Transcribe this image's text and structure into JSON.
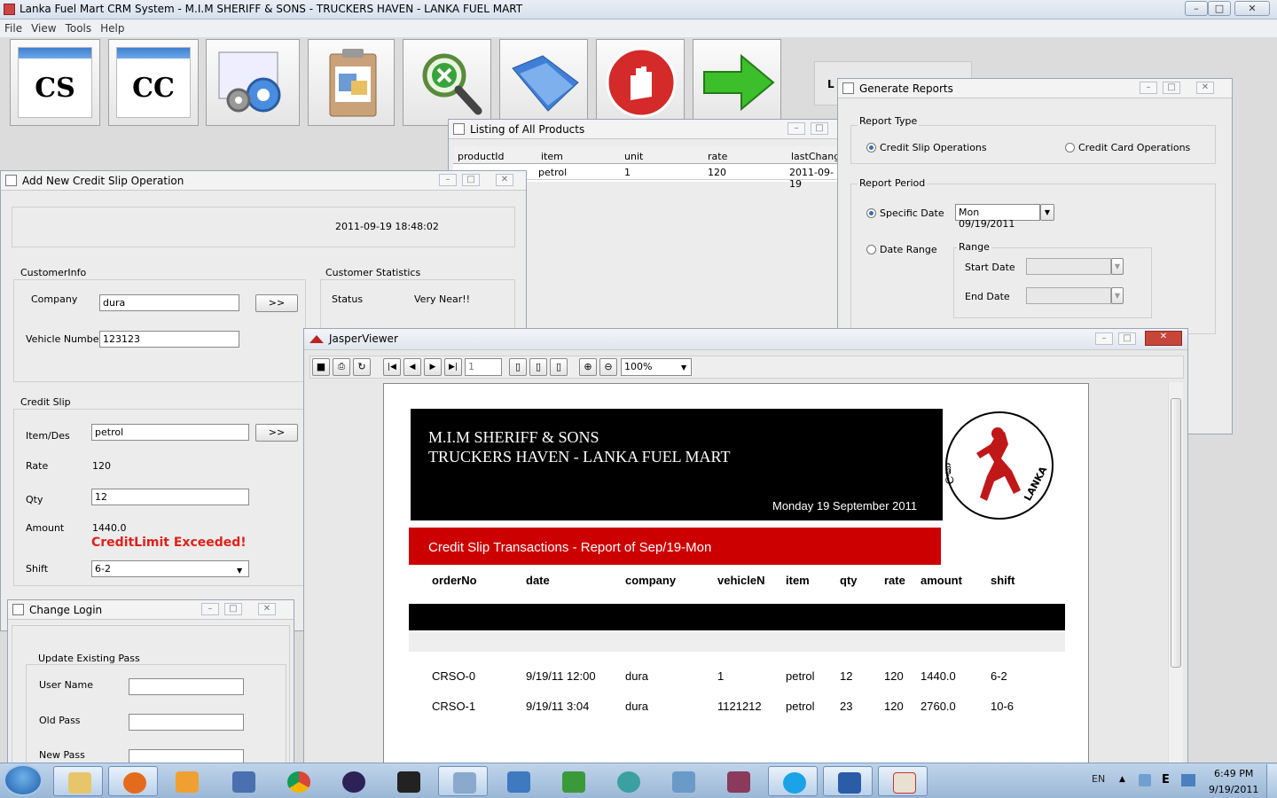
{
  "app": {
    "title": "Lanka Fuel Mart CRM System - M.I.M SHERIFF & SONS - TRUCKERS HAVEN - LANKA FUEL MART",
    "menu": [
      "File",
      "View",
      "Tools",
      "Help"
    ],
    "toolbar_labels": {
      "cs": "CS",
      "cc": "CC"
    }
  },
  "products_window": {
    "title": "Listing of All Products",
    "columns": [
      "productId",
      "item",
      "unit",
      "rate",
      "lastChang"
    ],
    "rows": [
      [
        "",
        "petrol",
        "1",
        "120",
        "2011-09-19"
      ]
    ]
  },
  "credit_slip_window": {
    "title": "Add New Credit Slip Operation",
    "datetime": "2011-09-19 18:48:02",
    "customer_info_label": "CustomerInfo",
    "company_label": "Company",
    "company_value": "dura",
    "vehicle_label": "Vehicle Number",
    "vehicle_value": "123123",
    "stats_label": "Customer Statistics",
    "status_label": "Status",
    "status_value": "Very Near!!",
    "credit_slip_label": "Credit Slip",
    "item_label": "Item/Des",
    "item_value": "petrol",
    "rate_label": "Rate",
    "rate_value": "120",
    "qty_label": "Qty",
    "qty_value": "12",
    "amount_label": "Amount",
    "amount_value": "1440.0",
    "warning": "CreditLimit Exceeded!",
    "shift_label": "Shift",
    "shift_value": "6-2",
    "lookup_button": ">>"
  },
  "login_window": {
    "title": "Change Login",
    "group_label": "Update Existing Pass",
    "user_label": "User Name",
    "old_label": "Old Pass",
    "new_label": "New Pass"
  },
  "reports_window": {
    "title": "Generate Reports",
    "report_type_label": "Report Type",
    "opt_credit_slip": "Credit Slip Operations",
    "opt_credit_card": "Credit Card Operations",
    "report_period_label": "Report Period",
    "opt_specific": "Specific Date",
    "specific_date_value": "Mon 09/19/2011",
    "opt_range": "Date Range",
    "range_label": "Range",
    "start_label": "Start Date",
    "end_label": "End Date",
    "hidden_label_stub": "L"
  },
  "jasper": {
    "title": "JasperViewer",
    "page_number": "1",
    "zoom": "100%",
    "header_line1": "M.I.M SHERIFF & SONS",
    "header_line2": "TRUCKERS HAVEN - LANKA FUEL MART",
    "header_date": "Monday 19 September 2011",
    "logo_text_left": "ලංකා",
    "logo_text_right": "LANKA",
    "report_title": "Credit Slip Transactions - Report of Sep/19-Mon",
    "columns": [
      "orderNo",
      "date",
      "company",
      "vehicleN",
      "item",
      "qty",
      "rate",
      "amount",
      "shift"
    ],
    "rows": [
      [
        "CRSO-0",
        "9/19/11 12:00",
        "dura",
        "1",
        "petrol",
        "12",
        "120",
        "1440.0",
        "6-2"
      ],
      [
        "CRSO-1",
        "9/19/11 3:04",
        "dura",
        "1121212",
        "petrol",
        "23",
        "120",
        "2760.0",
        "10-6"
      ]
    ]
  },
  "taskbar": {
    "lang": "EN",
    "tray_e": "E",
    "time": "6:49 PM",
    "date": "9/19/2011"
  },
  "colors": {
    "report_red": "#cc0000",
    "report_black": "#000000",
    "warning_red": "#e0201a"
  }
}
